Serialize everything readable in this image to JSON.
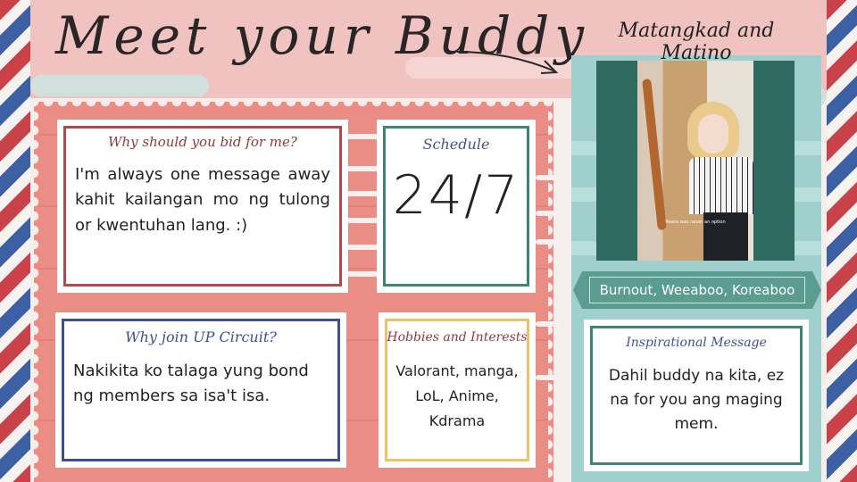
{
  "headline": "Meet your Buddy",
  "profile": {
    "name": "Matangkad and Matino",
    "photo_caption": "Peace was never an option",
    "tags": "Burnout, Weeaboo, Koreaboo"
  },
  "cards": {
    "why_bid": {
      "title": "Why should you bid for me?",
      "body": "I'm always one message away kahit kailangan mo ng tulong or kwentuhan lang. :)"
    },
    "schedule": {
      "title": "Schedule",
      "body": "24/7"
    },
    "why_join": {
      "title": "Why join UP Circuit?",
      "body": "Nakikita ko talaga yung bond ng members sa isa't isa."
    },
    "hobbies": {
      "title": "Hobbies and Interests",
      "body": "Valorant, manga, LoL, Anime, Kdrama"
    },
    "inspirational": {
      "title": "Inspirational Message",
      "body": "Dahil buddy na kita, ez na for you ang maging mem."
    }
  },
  "colors": {
    "pink_band": "#f0c3c1",
    "salmon": "#ee8a81",
    "teal": "#9fd0cd",
    "frame_red": "#b04a4f",
    "frame_teal": "#3f8476",
    "frame_navy": "#3f4f94",
    "frame_yellow": "#eac26a"
  }
}
